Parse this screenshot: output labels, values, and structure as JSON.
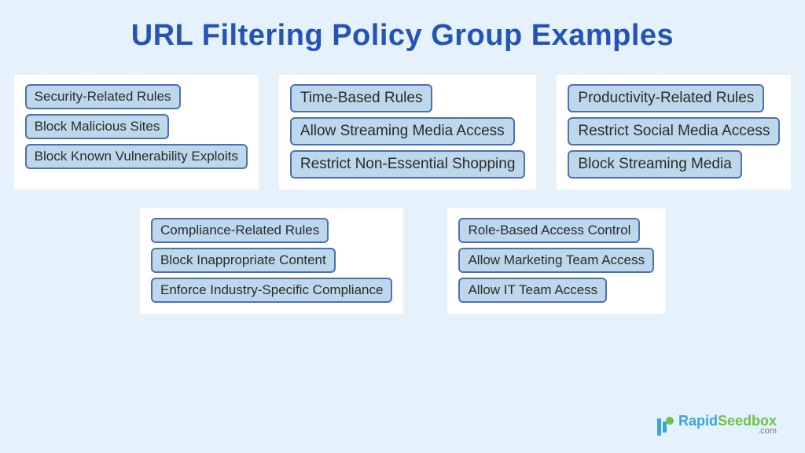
{
  "title": "URL Filtering Policy Group Examples",
  "row1": [
    {
      "size": "sm",
      "items": [
        "Security-Related Rules",
        "Block Malicious Sites",
        "Block Known Vulnerability Exploits"
      ]
    },
    {
      "size": "lg",
      "items": [
        "Time-Based Rules",
        "Allow Streaming Media Access",
        "Restrict Non-Essential Shopping"
      ]
    },
    {
      "size": "lg",
      "items": [
        "Productivity-Related Rules",
        "Restrict Social Media Access",
        "Block Streaming Media"
      ]
    }
  ],
  "row2": [
    {
      "size": "sm",
      "items": [
        "Compliance-Related Rules",
        "Block Inappropriate Content",
        "Enforce Industry-Specific Compliance"
      ]
    },
    {
      "size": "sm",
      "items": [
        "Role-Based Access Control",
        "Allow Marketing Team Access",
        "Allow IT Team Access"
      ]
    }
  ],
  "brand": {
    "name_a": "Rapid",
    "name_b": "Seedbox",
    "sub": ".com"
  }
}
